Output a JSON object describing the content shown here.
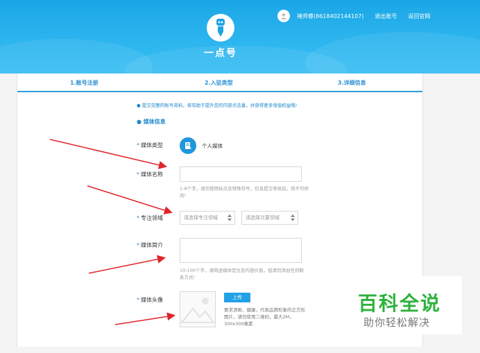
{
  "header": {
    "user_name": "褚师睿(8618402144107)",
    "logout_label": "退出账号",
    "home_label": "返回官网",
    "brand": "一点号"
  },
  "steps": [
    {
      "label": "1.账号注册"
    },
    {
      "label": "2.入驻类型"
    },
    {
      "label": "3.详细信息"
    }
  ],
  "form": {
    "notice": "● 提交完整的账号资料，将有助于提升您的内容点击量，并获得更多增值权益哦!",
    "section_title": "● 媒体信息",
    "media_type_label": "媒体类型",
    "media_type_value": "个人媒体",
    "media_name_label": "媒体名称",
    "media_name_hint": "1-8个字，请勿使用标点及特殊符号，信息提交审核后，将不可修改!",
    "domain_label": "专注领域",
    "domain_primary_placeholder": "请选择专注领域",
    "domain_secondary_placeholder": "请选择次要领域",
    "intro_label": "媒体简介",
    "intro_hint": "10-100个字，请简述媒体定位及内容价值，但请勿添加任何联系方式!",
    "avatar_label": "媒体头像",
    "upload_label": "上传",
    "avatar_hint": "要求清晰、健康，代表品牌形象的正方形图片，请勿使用二维码，最大2M，300x300像素"
  },
  "watermark": {
    "title": "百科全说",
    "subtitle": "助你轻松解决"
  },
  "colors": {
    "banner": "#1aa6e6",
    "accent": "#2b8fd3",
    "arrow": "#e0242b",
    "watermark_green": "#2fb23d"
  }
}
